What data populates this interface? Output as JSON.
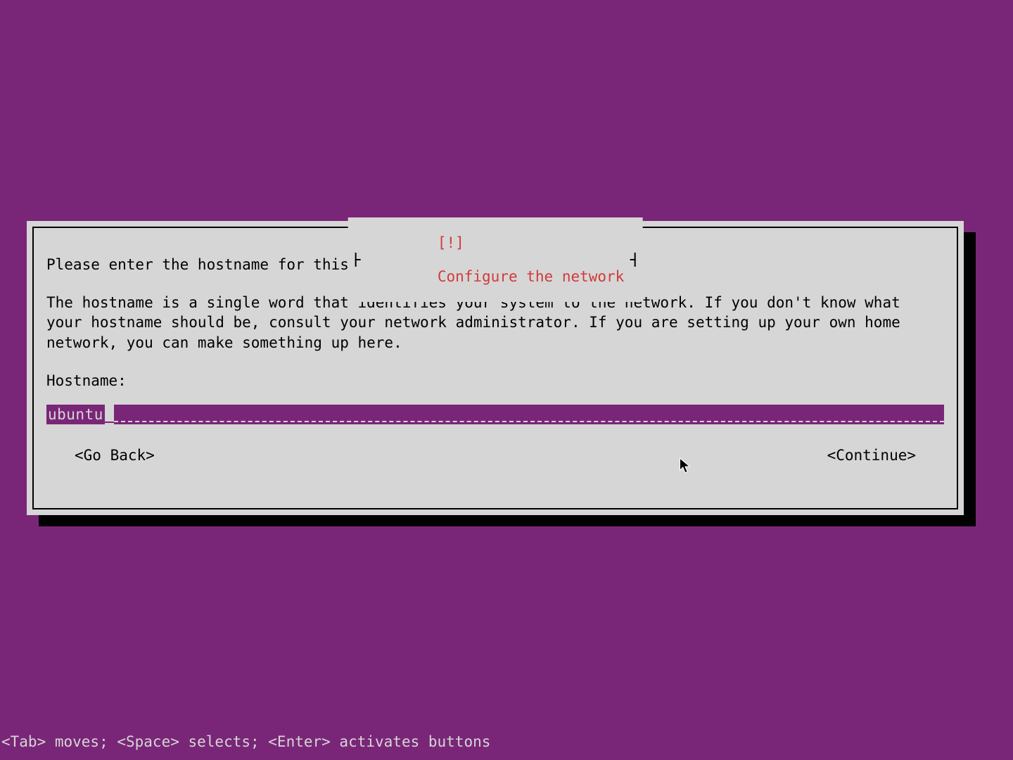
{
  "dialog": {
    "title_marker": "[!]",
    "title": "Configure the network",
    "intro": "Please enter the hostname for this system.",
    "description": "The hostname is a single word that identifies your system to the network. If you don't know what your hostname should be, consult your network administrator. If you are setting up your own home network, you can make something up here.",
    "field_label": "Hostname:",
    "field_value": "ubuntu",
    "buttons": {
      "back": "<Go Back>",
      "continue": "<Continue>"
    }
  },
  "help_bar": "<Tab> moves; <Space> selects; <Enter> activates buttons"
}
